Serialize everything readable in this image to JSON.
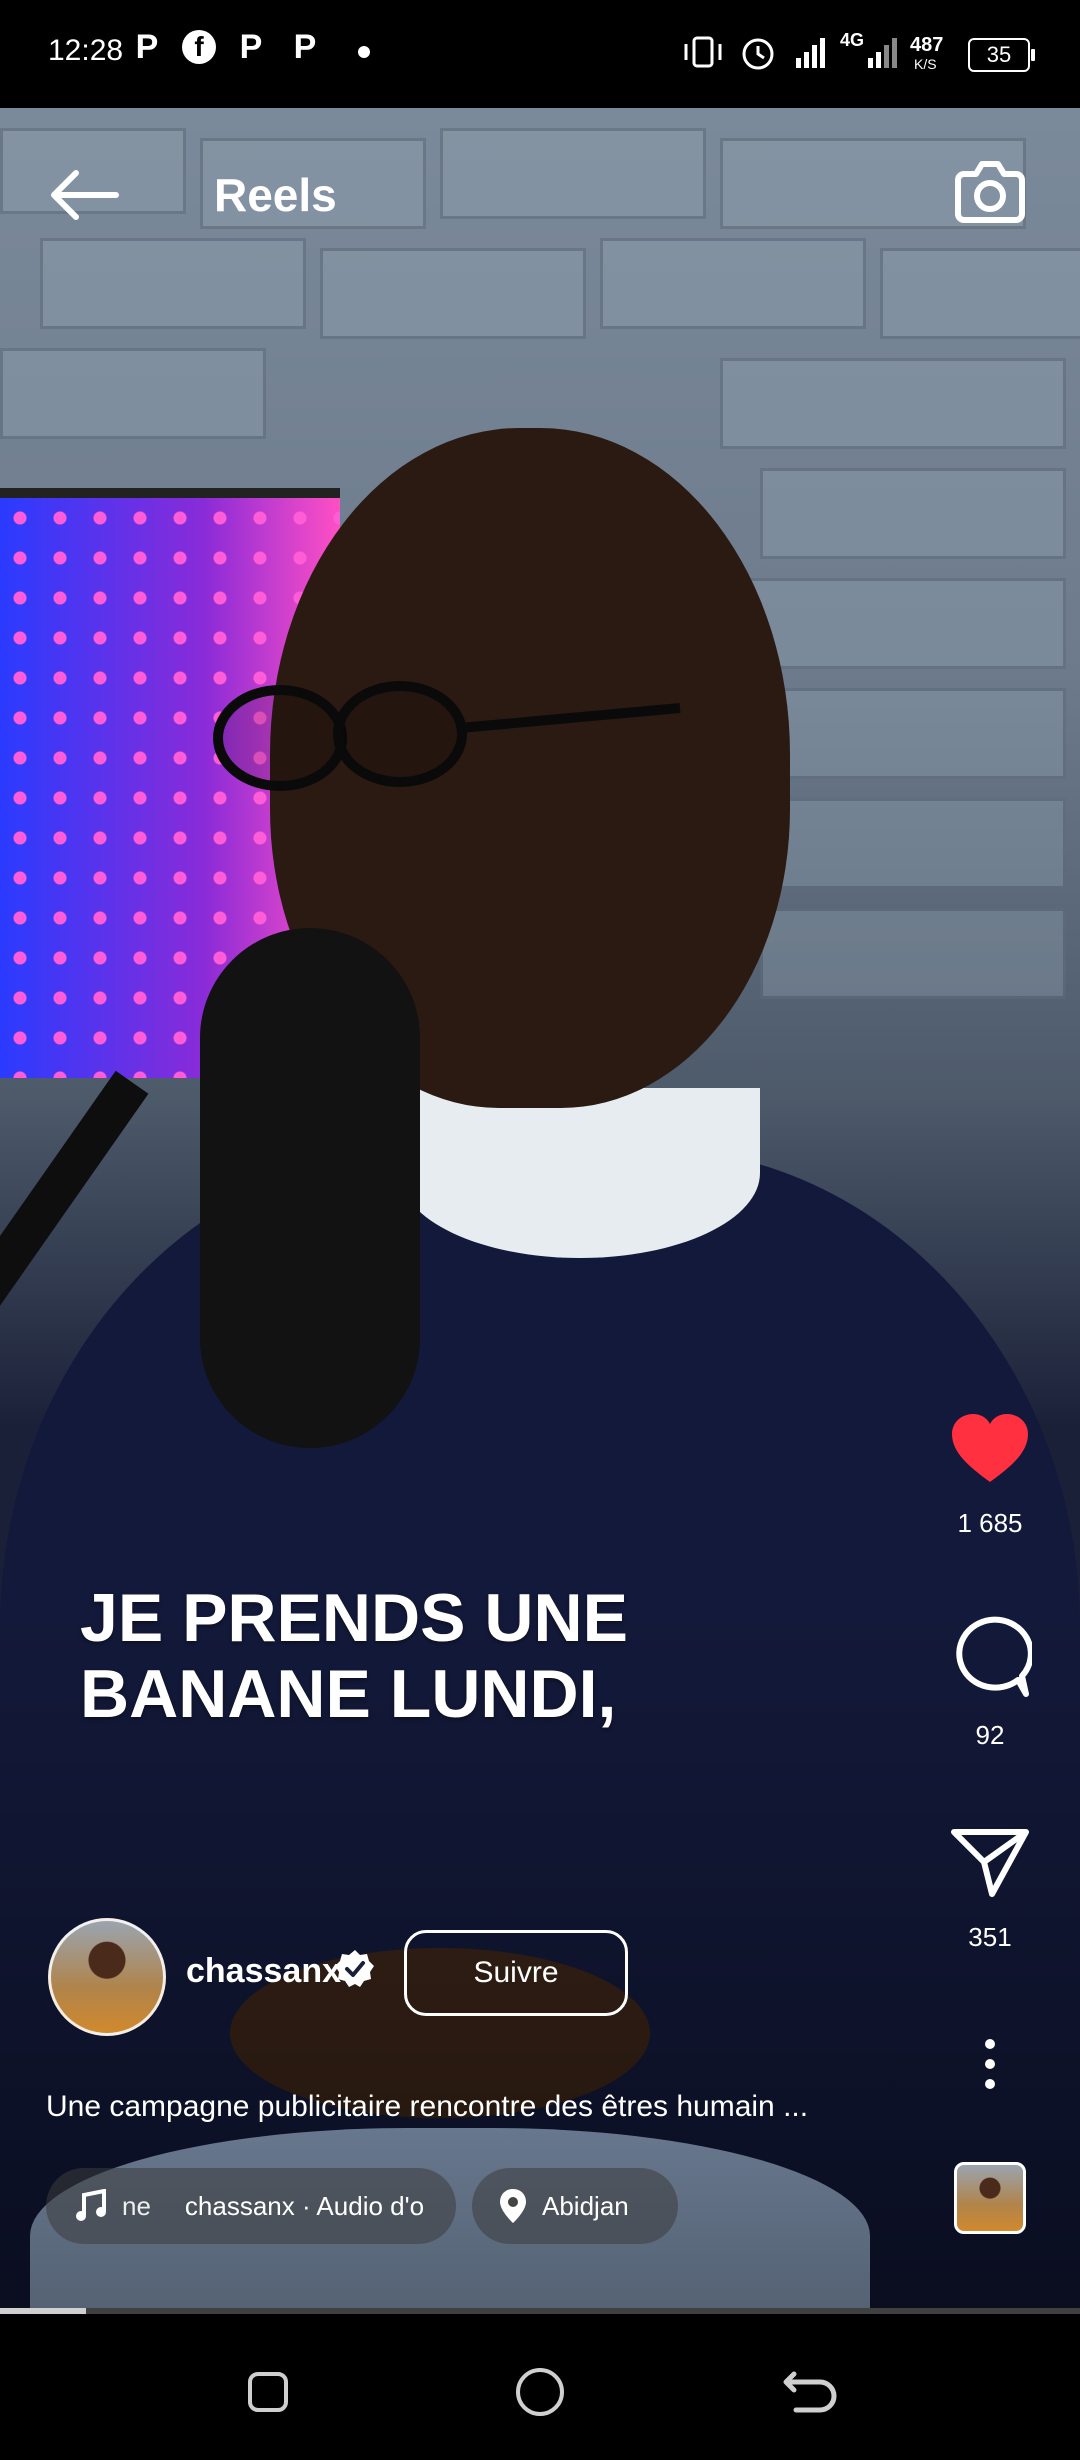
{
  "status_bar": {
    "time": "12:28",
    "app_icons": [
      "P",
      "f",
      "P",
      "P"
    ],
    "network_speed": "487",
    "network_unit": "K/S",
    "network_type": "4G",
    "battery": "35"
  },
  "header": {
    "title": "Reels"
  },
  "video": {
    "caption_line1": "JE PRENDS UNE",
    "caption_line2": "BANANE LUNDI,"
  },
  "actions": {
    "likes": "1 685",
    "comments": "92",
    "shares": "351",
    "like_color": "#ff3040"
  },
  "author": {
    "username": "chassanx",
    "follow_label": "Suivre"
  },
  "description": "Une campagne publicitaire rencontre des êtres humain ...",
  "audio": {
    "prefix": "ne",
    "label": "chassanx · Audio d'o"
  },
  "location": "Abidjan",
  "progress": 0.08
}
